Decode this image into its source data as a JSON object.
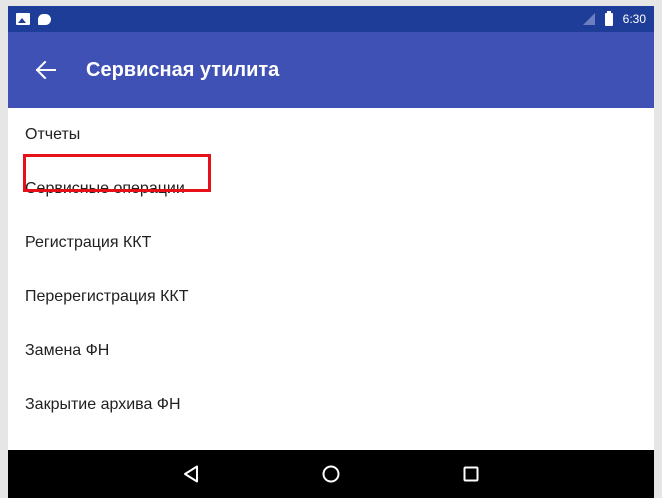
{
  "status_bar": {
    "time": "6:30",
    "icons": [
      "image-icon",
      "chat-icon",
      "signal-icon",
      "battery-icon"
    ]
  },
  "app_bar": {
    "back_icon": "arrow-left-icon",
    "title": "Сервисная утилита",
    "color": "#3f51b5"
  },
  "menu": {
    "items": [
      {
        "label": "Отчеты"
      },
      {
        "label": "Сервисные операции",
        "highlighted": true
      },
      {
        "label": "Регистрация ККТ"
      },
      {
        "label": "Перерегистрация ККТ"
      },
      {
        "label": "Замена ФН"
      },
      {
        "label": "Закрытие архива ФН"
      }
    ]
  },
  "highlight_color": "#e5101a",
  "nav_bar": {
    "buttons": [
      "back-triangle-icon",
      "home-circle-icon",
      "recent-apps-square-icon"
    ]
  }
}
